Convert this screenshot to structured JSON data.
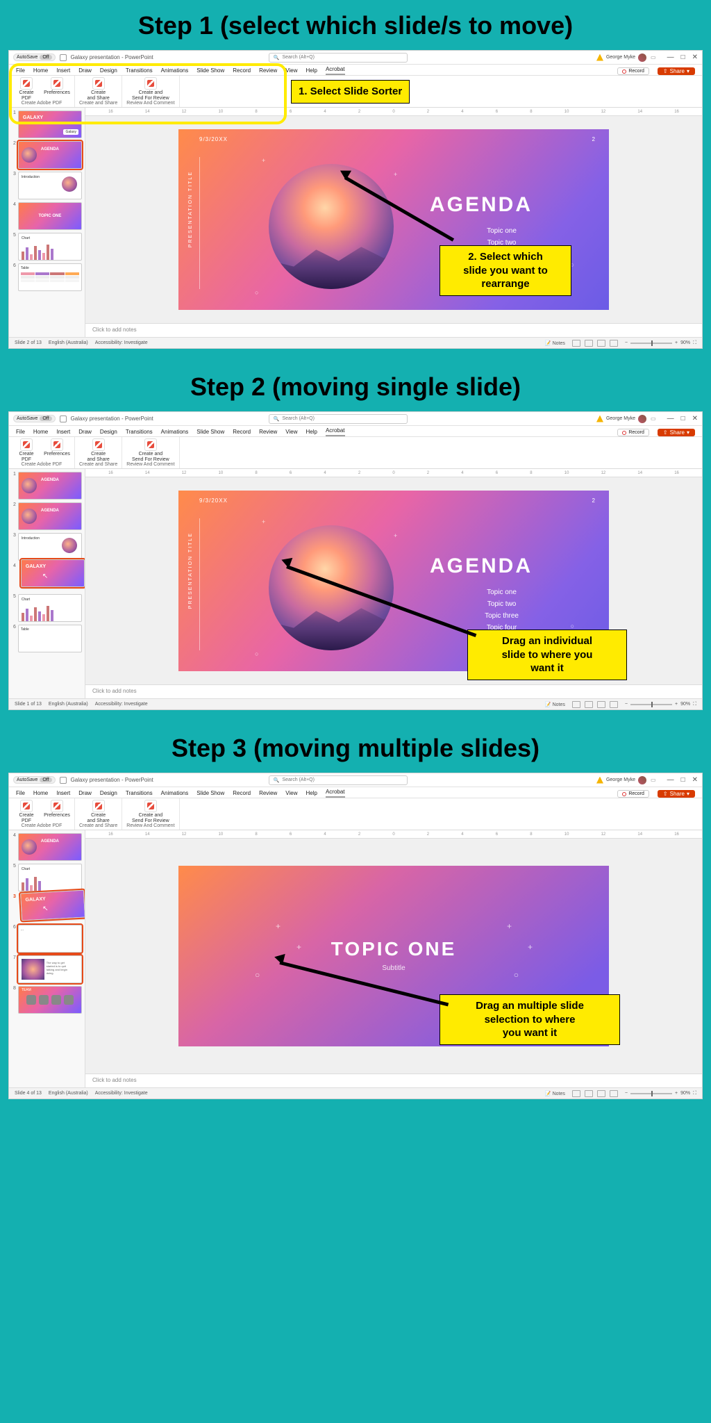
{
  "steps": [
    {
      "heading": "Step 1 (select which slide/s to move)"
    },
    {
      "heading": "Step 2 (moving single slide)"
    },
    {
      "heading": "Step 3 (moving multiple slides)"
    }
  ],
  "window": {
    "autosave_label": "AutoSave",
    "autosave_state": "Off",
    "doc_title": "Galaxy presentation - PowerPoint",
    "search_placeholder": "Search (Alt+Q)",
    "user_name": "George Myke",
    "min": "—",
    "max": "□",
    "close": "✕"
  },
  "ribbon_tabs": [
    "File",
    "Home",
    "Insert",
    "Draw",
    "Design",
    "Transitions",
    "Animations",
    "Slide Show",
    "Record",
    "Review",
    "View",
    "Help",
    "Acrobat"
  ],
  "ribbon_right": {
    "record": "Record",
    "share": "Share"
  },
  "ribbon_groups": {
    "g1": {
      "btn1": "Create\nPDF",
      "btn2": "Preferences",
      "label": "Create Adobe PDF"
    },
    "g2": {
      "btn1": "Create\nand Share",
      "label": "Create and Share"
    },
    "g3": {
      "btn1": "Create and\nSend For Review",
      "label": "Review And Comment"
    }
  },
  "ruler_marks": [
    "16",
    "14",
    "12",
    "10",
    "8",
    "6",
    "4",
    "2",
    "0",
    "2",
    "4",
    "6",
    "8",
    "10",
    "12",
    "14",
    "16"
  ],
  "main_slide": {
    "date": "9/3/20XX",
    "pagenum": "2",
    "vertical": "PRESENTATION TITLE",
    "title": "AGENDA",
    "topics3": "Topic one\nTopic two\nTopic three",
    "topics4": "Topic one\nTopic two\nTopic three\nTopic four"
  },
  "topic_slide": {
    "title": "TOPIC ONE",
    "subtitle": "Subtitle"
  },
  "notes_placeholder": "Click to add notes",
  "status": {
    "s1": {
      "slide": "Slide 2 of 13",
      "lang": "English (Australia)",
      "acc": "Accessibility: Investigate"
    },
    "s2": {
      "slide": "Slide 1 of 13",
      "lang": "English (Australia)",
      "acc": "Accessibility: Investigate"
    },
    "s3": {
      "slide": "Slide 4 of 13",
      "lang": "English (Australia)",
      "acc": "Accessibility: Investigate"
    },
    "notes": "Notes",
    "zoom": "90%"
  },
  "thumbs": {
    "galaxy": "GALAXY",
    "galaxy_badge": "Galaxy",
    "agenda": "AGENDA",
    "intro": "Introduction",
    "topic": "TOPIC ONE",
    "chart": "Chart",
    "table": "Table",
    "team": "TEAM"
  },
  "callouts": {
    "c1a": "1.   Select Slide Sorter",
    "c1b": "2. Select which\nslide you want to\nrearrange",
    "c2": "Drag an individual\nslide to where you\nwant it",
    "c3": "Drag an multiple slide\nselection to where\nyou want it"
  }
}
